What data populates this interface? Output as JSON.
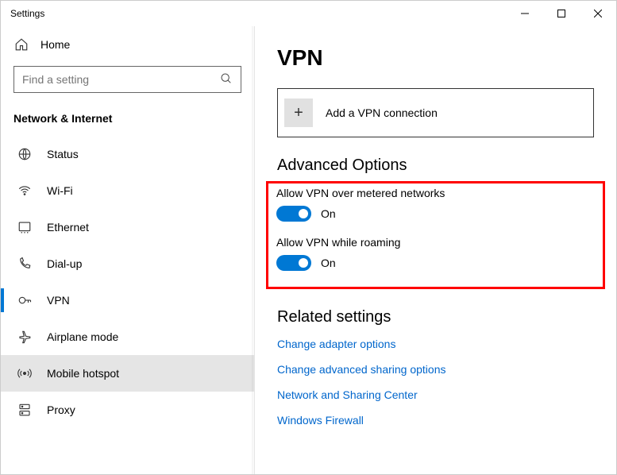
{
  "window": {
    "title": "Settings"
  },
  "sidebar": {
    "home": "Home",
    "search_placeholder": "Find a setting",
    "category": "Network & Internet",
    "items": [
      {
        "label": "Status"
      },
      {
        "label": "Wi-Fi"
      },
      {
        "label": "Ethernet"
      },
      {
        "label": "Dial-up"
      },
      {
        "label": "VPN"
      },
      {
        "label": "Airplane mode"
      },
      {
        "label": "Mobile hotspot"
      },
      {
        "label": "Proxy"
      }
    ]
  },
  "main": {
    "title": "VPN",
    "add_label": "Add a VPN connection",
    "advanced_heading": "Advanced Options",
    "option1_label": "Allow VPN over metered networks",
    "option1_state": "On",
    "option2_label": "Allow VPN while roaming",
    "option2_state": "On",
    "related_heading": "Related settings",
    "links": {
      "adapter": "Change adapter options",
      "sharing": "Change advanced sharing options",
      "center": "Network and Sharing Center",
      "firewall": "Windows Firewall"
    }
  }
}
